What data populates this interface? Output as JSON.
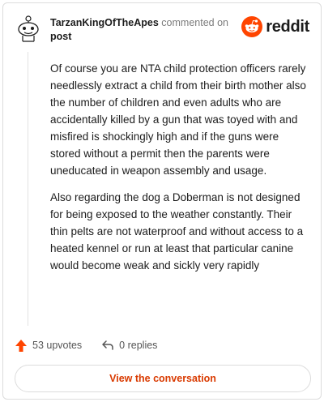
{
  "header": {
    "author": "TarzanKingOfTheApes",
    "action_text": "commented on",
    "post_link": "post",
    "logo_text": "reddit"
  },
  "comment": {
    "paragraphs": [
      "Of course you are NTA child protection officers rarely needlessly extract a child from their birth mother also the number of children and even adults who are accidentally killed by a gun that was toyed with and misfired is shockingly high and if the guns were stored without a permit then the parents were uneducated in weapon assembly and usage.",
      "Also regarding the dog a Doberman is not designed for being exposed to the weather constantly. Their thin pelts are not waterproof and without access to a heated kennel or run at least that particular canine would become weak and sickly very rapidly"
    ]
  },
  "footer": {
    "upvotes": "53 upvotes",
    "replies": "0 replies"
  },
  "cta": {
    "label": "View the conversation"
  },
  "colors": {
    "accent": "#ff4500",
    "link": "#d93a00"
  }
}
